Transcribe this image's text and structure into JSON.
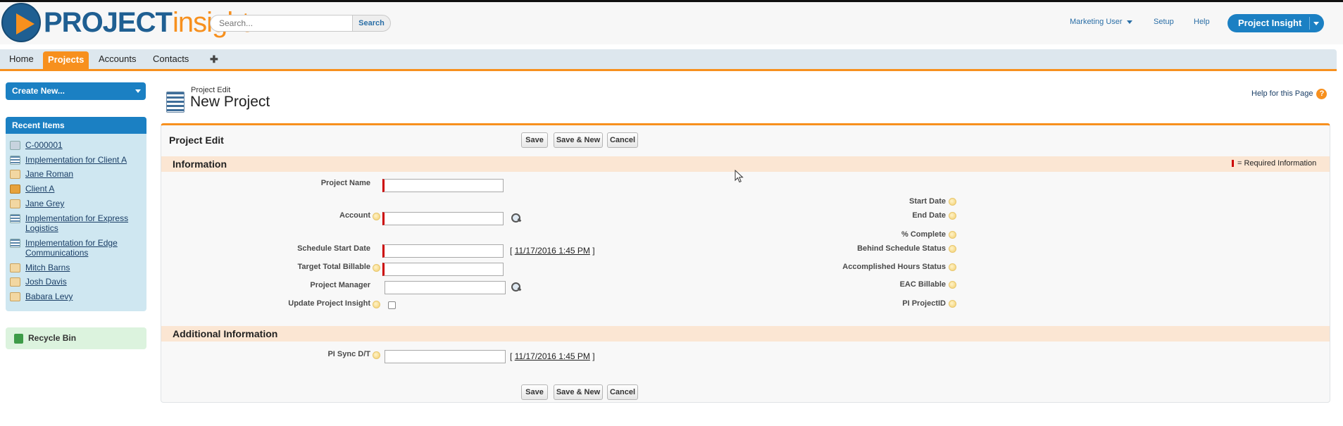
{
  "header": {
    "logo_part1": "PROJECT",
    "logo_part2": "insight",
    "search_placeholder": "Search...",
    "search_button": "Search",
    "user_menu": "Marketing User",
    "setup": "Setup",
    "help": "Help",
    "app_switcher": "Project Insight"
  },
  "tabs": {
    "home": "Home",
    "projects": "Projects",
    "accounts": "Accounts",
    "contacts": "Contacts",
    "plus": "✚"
  },
  "sidebar": {
    "create_new": "Create New...",
    "recent_title": "Recent Items",
    "recent_items": [
      {
        "label": "C-000001",
        "icon": "contract-icon"
      },
      {
        "label": "Implementation for Client A",
        "icon": "project-icon"
      },
      {
        "label": "Jane Roman",
        "icon": "contact-icon"
      },
      {
        "label": "Client A",
        "icon": "account-icon"
      },
      {
        "label": "Jane Grey",
        "icon": "contact-icon"
      },
      {
        "label": "Implementation for Express Logistics",
        "icon": "project-icon"
      },
      {
        "label": "Implementation for Edge Communications",
        "icon": "project-icon"
      },
      {
        "label": "Mitch Barns",
        "icon": "contact-icon"
      },
      {
        "label": "Josh Davis",
        "icon": "contact-icon"
      },
      {
        "label": "Babara Levy",
        "icon": "contact-icon"
      }
    ],
    "recycle_bin": "Recycle Bin"
  },
  "page": {
    "subtitle": "Project Edit",
    "title": "New Project",
    "help_link": "Help for this Page",
    "help_icon": "?"
  },
  "form": {
    "title": "Project Edit",
    "save": "Save",
    "save_new": "Save & New",
    "cancel": "Cancel",
    "required_legend": "= Required Information",
    "section_info": "Information",
    "section_additional": "Additional Information",
    "labels": {
      "project_name": "Project Name",
      "account": "Account",
      "schedule_start_date": "Schedule Start Date",
      "target_total_billable": "Target Total Billable",
      "project_manager": "Project Manager",
      "update_project_insight": "Update Project Insight",
      "start_date": "Start Date",
      "end_date": "End Date",
      "pct_complete": "% Complete",
      "behind_schedule_status": "Behind Schedule Status",
      "accomplished_hours_status": "Accomplished Hours Status",
      "eac_billable": "EAC Billable",
      "pi_project_id": "PI ProjectID",
      "pi_sync_dt": "PI Sync D/T"
    },
    "values": {
      "project_name": "",
      "account": "",
      "schedule_start_date": "",
      "target_total_billable": "",
      "project_manager": "",
      "pi_sync_dt": ""
    },
    "date_shortcut": "11/17/2016 1:45 PM",
    "bracket_open": "[",
    "bracket_close": "]"
  },
  "colors": {
    "brand_blue": "#1b80c3",
    "accent_orange": "#f7901e",
    "required_red": "#cc0000",
    "section_bg": "#fbe6d3"
  }
}
